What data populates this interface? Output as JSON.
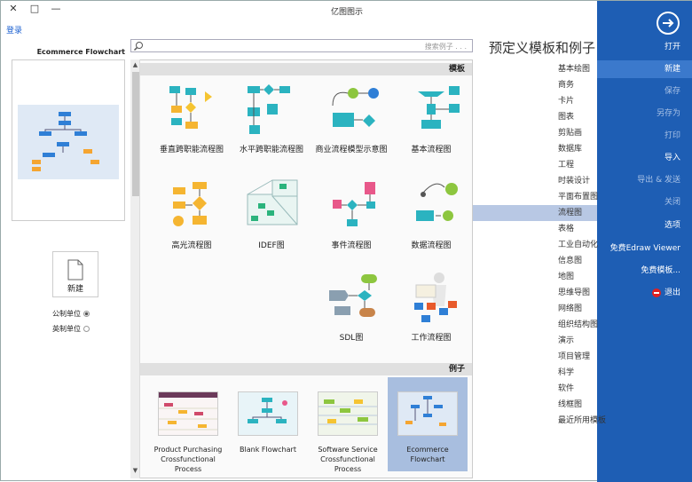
{
  "window": {
    "title": "亿图图示",
    "close_glyph": "✕",
    "max_glyph": "□",
    "min_glyph": "—"
  },
  "login_label": "登录",
  "side_menu": {
    "items": [
      {
        "label": "打开"
      },
      {
        "label": "新建"
      },
      {
        "label": "保存"
      },
      {
        "label": "另存为"
      },
      {
        "label": "打印"
      },
      {
        "label": "导入"
      },
      {
        "label": "导出 & 发送"
      },
      {
        "label": "关闭"
      },
      {
        "label": "选项"
      },
      {
        "label": "免费Edraw Viewer"
      },
      {
        "label": "免费模板..."
      },
      {
        "label": "退出"
      }
    ]
  },
  "page_title": "预定义模板和例子",
  "categories": [
    "基本绘图",
    "商务",
    "卡片",
    "图表",
    "剪贴画",
    "数据库",
    "工程",
    "时装设计",
    "平面布置图",
    "流程图",
    "表格",
    "工业自动化",
    "信息图",
    "地图",
    "思维导图",
    "网络图",
    "组织结构图",
    "演示",
    "项目管理",
    "科学",
    "软件",
    "线框图",
    "最近所用模板"
  ],
  "selected_category": "流程图",
  "search": {
    "placeholder": "搜索例子 . . ."
  },
  "sections": {
    "templates": "模板",
    "examples": "例子"
  },
  "templates": [
    {
      "label": "基本流程图"
    },
    {
      "label": "商业流程模型示意图"
    },
    {
      "label": "水平跨职能流程图"
    },
    {
      "label": "垂直跨职能流程图"
    },
    {
      "label": "数据流程图"
    },
    {
      "label": "事件流程图"
    },
    {
      "label": "IDEF图"
    },
    {
      "label": "高光流程图"
    },
    {
      "label": "工作流程图"
    },
    {
      "label": "SDL图"
    }
  ],
  "examples": [
    {
      "label": "Ecommerce\nFlowchart"
    },
    {
      "label": "Software Service\nCrossfunctional\nProcess"
    },
    {
      "label": "Blank Flowchart"
    },
    {
      "label": "Product Purchasing\nCrossfunctional\nProcess"
    }
  ],
  "preview": {
    "title": "Ecommerce Flowchart"
  },
  "new_button": {
    "label": "新建"
  },
  "units": [
    {
      "label": "公制单位",
      "selected": true
    },
    {
      "label": "英制单位",
      "selected": false
    }
  ],
  "colors": {
    "accent": "#1e5eb4",
    "selected_menu": "#3b79cc",
    "selected_category": "#b8c8e4"
  }
}
